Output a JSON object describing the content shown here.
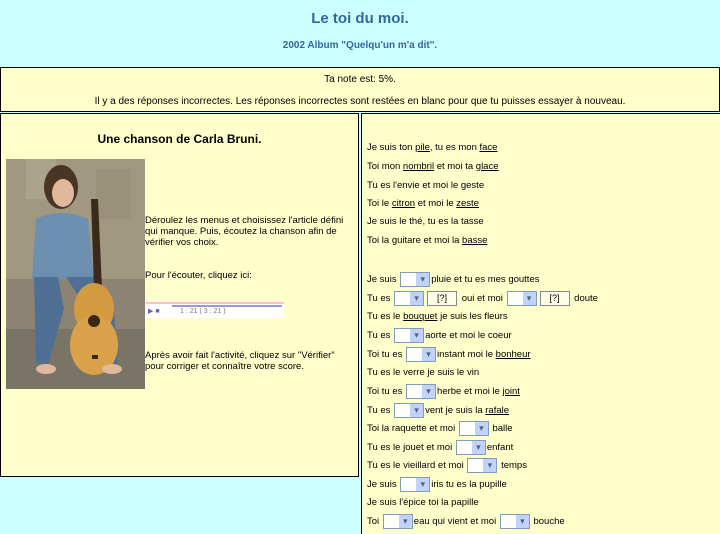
{
  "header": {
    "title": "Le toi du moi.",
    "subtitle": "2002 Album \"Quelqu'un m'a dit\"."
  },
  "score": {
    "line1": "Ta note est: 5%.",
    "line2": "Il y a des réponses incorrectes. Les réponses incorrectes sont restées en blanc pour que tu puisses essayer à nouveau."
  },
  "left": {
    "heading": "Une chanson de Carla Bruni.",
    "instructions": "Déroulez les menus et choisissez l'article défini qui manque. Puis, écoutez la chanson afin de vérifier vos choix.",
    "listen": "Pour l'écouter, cliquez ici:",
    "player_time": "1 : 21    ( 3 : 21 )",
    "finish": "Après avoir fait l'activité, cliquez sur \"Vérifier\" pour corriger et connaître votre score."
  },
  "lyrics": {
    "l1": [
      "Je suis ton ",
      "pile",
      ", tu es mon ",
      "face"
    ],
    "l2": [
      "Toi mon ",
      "nombril",
      " et moi ta ",
      "glace"
    ],
    "l3": "Tu es l'envie et moi le geste",
    "l4": [
      "Toi le ",
      "citron",
      " et moi le ",
      "zeste"
    ],
    "l5": "Je suis le thé, tu es la tasse",
    "l6": [
      "Toi la guitare et moi la ",
      "basse"
    ],
    "q1": [
      "Je suis",
      "pluie et tu es mes gouttes"
    ],
    "q2": [
      "Tu es",
      "[?]",
      "oui et moi",
      "[?]",
      "doute"
    ],
    "q3": [
      "Tu es le ",
      "bouquet",
      " je suis les fleurs"
    ],
    "q4": [
      "Tu es",
      "aorte et moi le coeur"
    ],
    "q5": [
      "Toi tu es",
      "instant moi le ",
      "bonheur"
    ],
    "q6": "Tu es le verre je suis le vin",
    "q7": [
      "Toi tu es",
      "herbe et moi le ",
      "joint"
    ],
    "q8": [
      "Tu es",
      "vent je suis la ",
      "rafale"
    ],
    "q9": [
      "Toi la raquette et moi",
      "balle"
    ],
    "q10": [
      "Tu es le jouet et moi",
      "enfant"
    ],
    "q11": [
      "Tu es le vieillard et moi",
      "temps"
    ],
    "q12": [
      "Je suis",
      "iris tu es la pupille"
    ],
    "q13": "Je suis l'épice toi la papille",
    "q14": [
      "Toi",
      "eau qui vient et moi",
      "bouche"
    ]
  }
}
